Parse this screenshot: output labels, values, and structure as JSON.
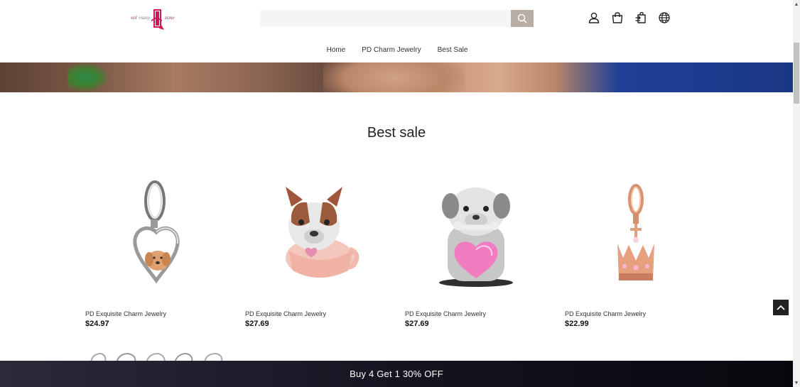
{
  "logo": {
    "name": "solvsasy zone"
  },
  "search": {
    "placeholder": ""
  },
  "header_icons": [
    "user-icon",
    "bag-icon",
    "bag-swap-icon",
    "globe-icon"
  ],
  "nav": {
    "items": [
      "Home",
      "PD Charm Jewelry",
      "Best Sale"
    ]
  },
  "section": {
    "title": "Best sale"
  },
  "products": [
    {
      "name": "PD Exquisite Charm Jewelry",
      "price": "$24.97",
      "image": "heart-dog-charm"
    },
    {
      "name": "PD Exquisite Charm Jewelry",
      "price": "$27.69",
      "image": "bulldog-cup-charm"
    },
    {
      "name": "PD Exquisite Charm Jewelry",
      "price": "$27.69",
      "image": "puppy-heart-charm"
    },
    {
      "name": "PD Exquisite Charm Jewelry",
      "price": "$22.99",
      "image": "crown-charm"
    }
  ],
  "promo": {
    "text": "Buy 4 Get 1 30% OFF"
  },
  "colors": {
    "search_button": "#b8aea6",
    "promo_bar": "#151522",
    "back_to_top": "#222222"
  }
}
